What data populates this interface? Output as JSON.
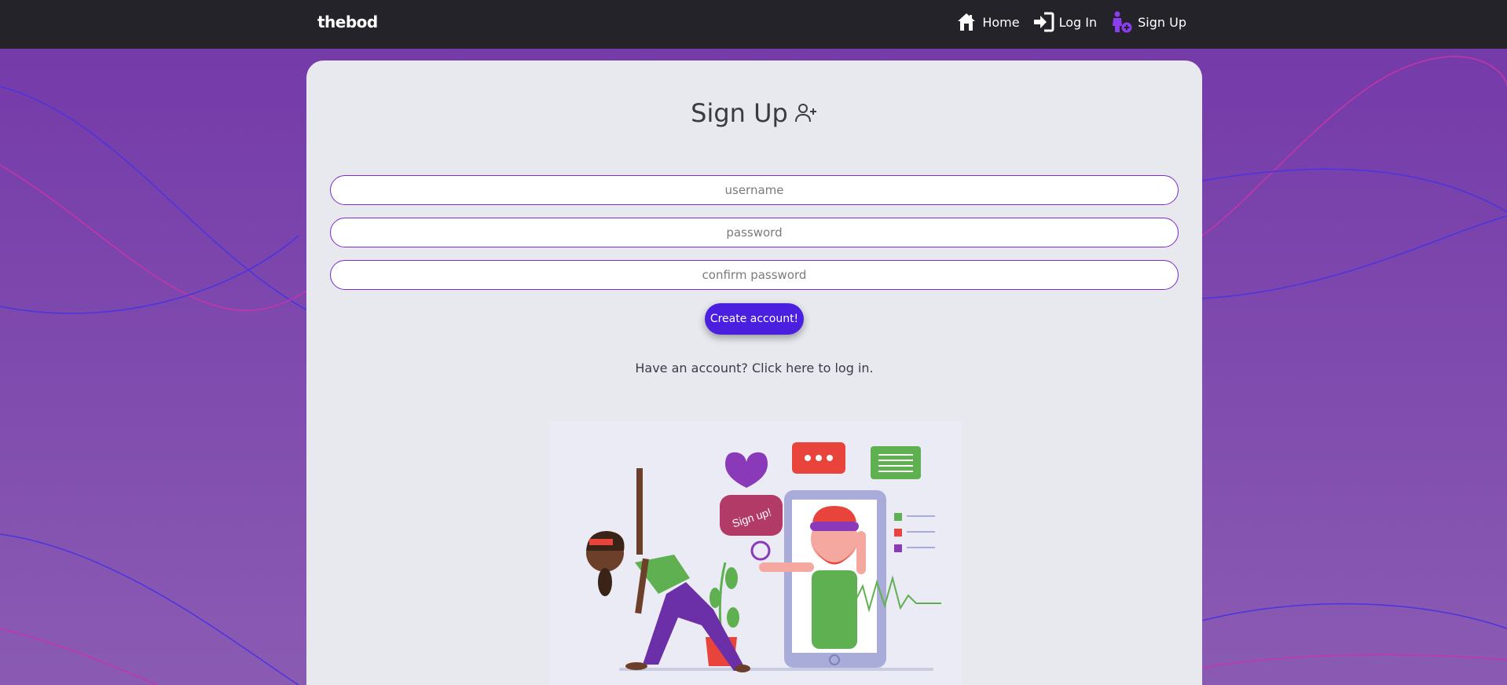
{
  "nav": {
    "brand": "thebod",
    "links": [
      {
        "label": "Home",
        "icon": "home-icon"
      },
      {
        "label": "Log In",
        "icon": "login-icon"
      },
      {
        "label": "Sign Up",
        "icon": "user-plus-icon"
      }
    ]
  },
  "form": {
    "title": "Sign Up",
    "title_icon": "user-plus-outline-icon",
    "username_placeholder": "username",
    "password_placeholder": "password",
    "confirm_placeholder": "confirm password",
    "submit_label": "Create account!",
    "login_prompt": "Have an account? Click here to log in."
  },
  "illustration": {
    "bubble_text": "Sign up!"
  },
  "colors": {
    "navbar": "#242329",
    "accent": "#4a1fe0",
    "field_border": "#7b2cc9",
    "card_bg": "#e7e9ee"
  }
}
